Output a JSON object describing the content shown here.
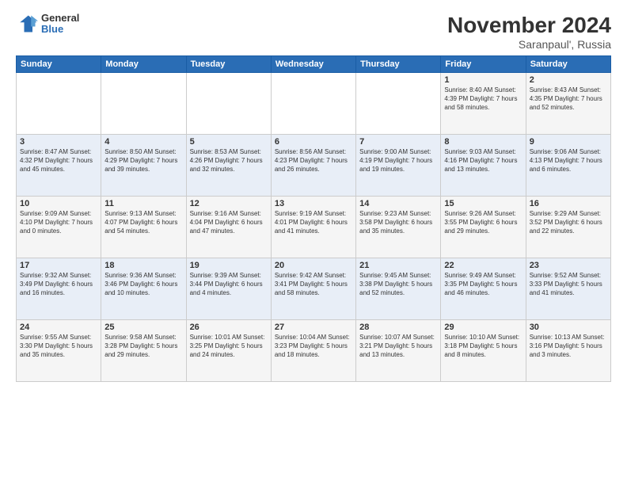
{
  "logo": {
    "general": "General",
    "blue": "Blue"
  },
  "title": "November 2024",
  "subtitle": "Saranpaul', Russia",
  "days_header": [
    "Sunday",
    "Monday",
    "Tuesday",
    "Wednesday",
    "Thursday",
    "Friday",
    "Saturday"
  ],
  "weeks": [
    [
      {
        "day": "",
        "info": ""
      },
      {
        "day": "",
        "info": ""
      },
      {
        "day": "",
        "info": ""
      },
      {
        "day": "",
        "info": ""
      },
      {
        "day": "",
        "info": ""
      },
      {
        "day": "1",
        "info": "Sunrise: 8:40 AM\nSunset: 4:39 PM\nDaylight: 7 hours\nand 58 minutes."
      },
      {
        "day": "2",
        "info": "Sunrise: 8:43 AM\nSunset: 4:35 PM\nDaylight: 7 hours\nand 52 minutes."
      }
    ],
    [
      {
        "day": "3",
        "info": "Sunrise: 8:47 AM\nSunset: 4:32 PM\nDaylight: 7 hours\nand 45 minutes."
      },
      {
        "day": "4",
        "info": "Sunrise: 8:50 AM\nSunset: 4:29 PM\nDaylight: 7 hours\nand 39 minutes."
      },
      {
        "day": "5",
        "info": "Sunrise: 8:53 AM\nSunset: 4:26 PM\nDaylight: 7 hours\nand 32 minutes."
      },
      {
        "day": "6",
        "info": "Sunrise: 8:56 AM\nSunset: 4:23 PM\nDaylight: 7 hours\nand 26 minutes."
      },
      {
        "day": "7",
        "info": "Sunrise: 9:00 AM\nSunset: 4:19 PM\nDaylight: 7 hours\nand 19 minutes."
      },
      {
        "day": "8",
        "info": "Sunrise: 9:03 AM\nSunset: 4:16 PM\nDaylight: 7 hours\nand 13 minutes."
      },
      {
        "day": "9",
        "info": "Sunrise: 9:06 AM\nSunset: 4:13 PM\nDaylight: 7 hours\nand 6 minutes."
      }
    ],
    [
      {
        "day": "10",
        "info": "Sunrise: 9:09 AM\nSunset: 4:10 PM\nDaylight: 7 hours\nand 0 minutes."
      },
      {
        "day": "11",
        "info": "Sunrise: 9:13 AM\nSunset: 4:07 PM\nDaylight: 6 hours\nand 54 minutes."
      },
      {
        "day": "12",
        "info": "Sunrise: 9:16 AM\nSunset: 4:04 PM\nDaylight: 6 hours\nand 47 minutes."
      },
      {
        "day": "13",
        "info": "Sunrise: 9:19 AM\nSunset: 4:01 PM\nDaylight: 6 hours\nand 41 minutes."
      },
      {
        "day": "14",
        "info": "Sunrise: 9:23 AM\nSunset: 3:58 PM\nDaylight: 6 hours\nand 35 minutes."
      },
      {
        "day": "15",
        "info": "Sunrise: 9:26 AM\nSunset: 3:55 PM\nDaylight: 6 hours\nand 29 minutes."
      },
      {
        "day": "16",
        "info": "Sunrise: 9:29 AM\nSunset: 3:52 PM\nDaylight: 6 hours\nand 22 minutes."
      }
    ],
    [
      {
        "day": "17",
        "info": "Sunrise: 9:32 AM\nSunset: 3:49 PM\nDaylight: 6 hours\nand 16 minutes."
      },
      {
        "day": "18",
        "info": "Sunrise: 9:36 AM\nSunset: 3:46 PM\nDaylight: 6 hours\nand 10 minutes."
      },
      {
        "day": "19",
        "info": "Sunrise: 9:39 AM\nSunset: 3:44 PM\nDaylight: 6 hours\nand 4 minutes."
      },
      {
        "day": "20",
        "info": "Sunrise: 9:42 AM\nSunset: 3:41 PM\nDaylight: 5 hours\nand 58 minutes."
      },
      {
        "day": "21",
        "info": "Sunrise: 9:45 AM\nSunset: 3:38 PM\nDaylight: 5 hours\nand 52 minutes."
      },
      {
        "day": "22",
        "info": "Sunrise: 9:49 AM\nSunset: 3:35 PM\nDaylight: 5 hours\nand 46 minutes."
      },
      {
        "day": "23",
        "info": "Sunrise: 9:52 AM\nSunset: 3:33 PM\nDaylight: 5 hours\nand 41 minutes."
      }
    ],
    [
      {
        "day": "24",
        "info": "Sunrise: 9:55 AM\nSunset: 3:30 PM\nDaylight: 5 hours\nand 35 minutes."
      },
      {
        "day": "25",
        "info": "Sunrise: 9:58 AM\nSunset: 3:28 PM\nDaylight: 5 hours\nand 29 minutes."
      },
      {
        "day": "26",
        "info": "Sunrise: 10:01 AM\nSunset: 3:25 PM\nDaylight: 5 hours\nand 24 minutes."
      },
      {
        "day": "27",
        "info": "Sunrise: 10:04 AM\nSunset: 3:23 PM\nDaylight: 5 hours\nand 18 minutes."
      },
      {
        "day": "28",
        "info": "Sunrise: 10:07 AM\nSunset: 3:21 PM\nDaylight: 5 hours\nand 13 minutes."
      },
      {
        "day": "29",
        "info": "Sunrise: 10:10 AM\nSunset: 3:18 PM\nDaylight: 5 hours\nand 8 minutes."
      },
      {
        "day": "30",
        "info": "Sunrise: 10:13 AM\nSunset: 3:16 PM\nDaylight: 5 hours\nand 3 minutes."
      }
    ]
  ]
}
